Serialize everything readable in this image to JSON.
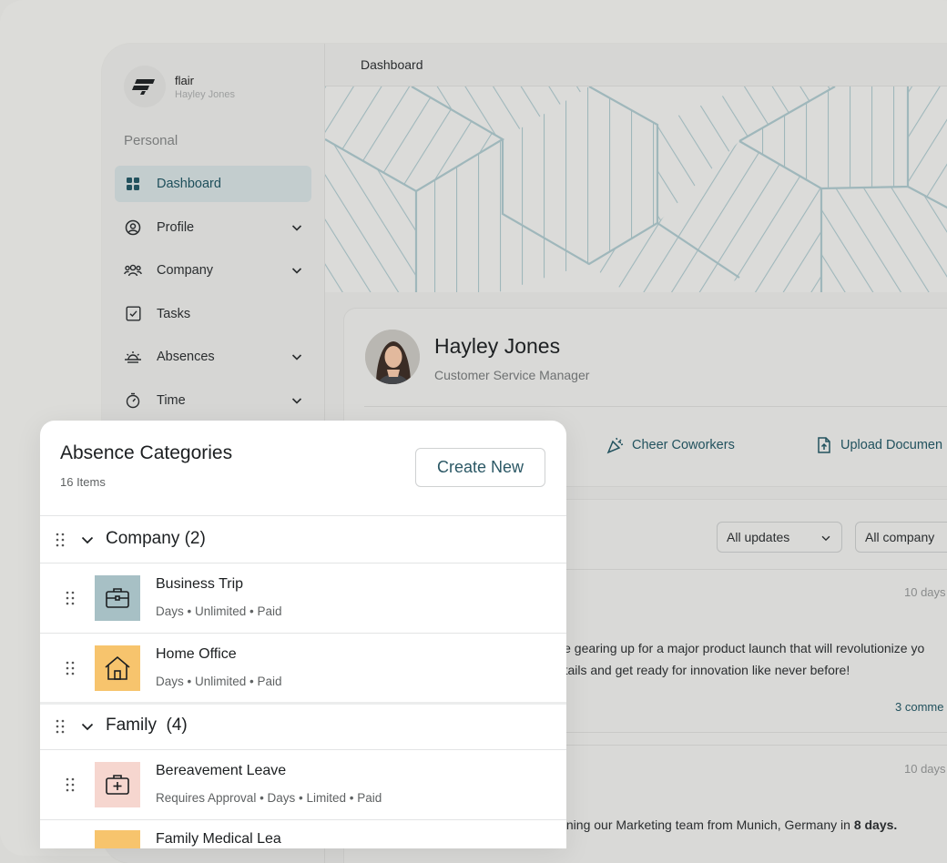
{
  "colors": {
    "accent": "#22525e",
    "sidebar_active_bg": "#c3cdce",
    "tile_business": "#a7c0c5",
    "tile_home": "#f7c46d",
    "tile_bereavement": "#f6d6cf",
    "banner_lines": "#9fb7bb"
  },
  "brand": {
    "name": "flair",
    "user": "Hayley Jones",
    "logo_icon": "flair-logo-icon"
  },
  "sidebar": {
    "section": "Personal",
    "items": [
      {
        "label": "Dashboard",
        "icon": "grid-icon",
        "active": true,
        "has_children": false
      },
      {
        "label": "Profile",
        "icon": "user-circle-icon",
        "active": false,
        "has_children": true
      },
      {
        "label": "Company",
        "icon": "people-icon",
        "active": false,
        "has_children": true
      },
      {
        "label": "Tasks",
        "icon": "checkbox-icon",
        "active": false,
        "has_children": false
      },
      {
        "label": "Absences",
        "icon": "sunrise-icon",
        "active": false,
        "has_children": true
      },
      {
        "label": "Time",
        "icon": "stopwatch-icon",
        "active": false,
        "has_children": true
      }
    ]
  },
  "header": {
    "title": "Dashboard"
  },
  "profile": {
    "name": "Hayley Jones",
    "role": "Customer Service Manager",
    "actions": [
      {
        "label": "Cheer Coworkers",
        "icon": "party-popper-icon"
      },
      {
        "label": "Upload Documen",
        "icon": "upload-file-icon"
      }
    ]
  },
  "feed": {
    "filters": [
      {
        "label": "All updates"
      },
      {
        "label": "All company"
      }
    ],
    "posts": [
      {
        "time": "10 days",
        "line1": "e're gearing up for a major product launch that will revolutionize yo",
        "line2": "details and get ready for innovation like never before!",
        "comments": "3 comme"
      },
      {
        "time": "10 days",
        "line1_prefix": "Joining our Marketing team from Munich, Germany in ",
        "line1_bold": "8 days."
      }
    ]
  },
  "absence_panel": {
    "title": "Absence Categories",
    "count": "16 Items",
    "create_label": "Create New",
    "groups": [
      {
        "label": "Company (2)",
        "items": [
          {
            "title": "Business Trip",
            "meta": "Days • Unlimited • Paid",
            "icon": "briefcase-icon"
          },
          {
            "title": "Home Office",
            "meta": "Days • Unlimited • Paid",
            "icon": "house-icon"
          }
        ]
      },
      {
        "label": "Family  (4)",
        "items": [
          {
            "title": "Bereavement Leave",
            "meta": "Requires Approval • Days • Limited • Paid",
            "icon": "medical-case-icon"
          },
          {
            "title": "Family Medical Lea",
            "meta": "",
            "icon": "family-icon"
          }
        ]
      }
    ]
  }
}
